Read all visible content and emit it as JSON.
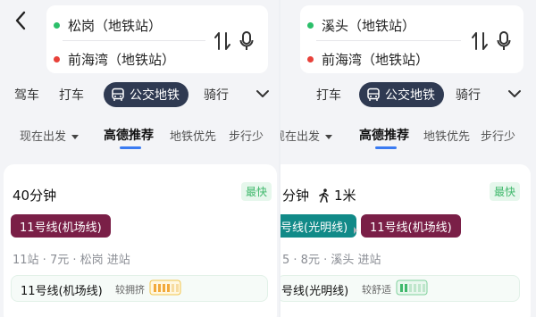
{
  "left": {
    "from": "松岗（地铁站）",
    "to": "前海湾（地铁站）",
    "modes": [
      "驾车",
      "打车",
      "公交地铁",
      "骑行"
    ],
    "prefs": [
      "现在出发",
      "高德推荐",
      "地铁优先",
      "步行少"
    ],
    "card": {
      "duration": "40分钟",
      "badge": "最快",
      "line": "11号线(机场线)",
      "meta": "11站 · 7元 · 松岗  进站",
      "detail_line": "11号线(机场线)",
      "crowd": "较拥挤"
    }
  },
  "right": {
    "from": "溪头（地铁站）",
    "to": "前海湾（地铁站）",
    "modes": [
      "打车",
      "公交地铁",
      "骑行"
    ],
    "prefs": [
      "现在出发",
      "高德推荐",
      "地铁优先",
      "步行少"
    ],
    "card": {
      "duration": "分钟",
      "walk": "1米",
      "badge": "最快",
      "line1": "号线(光明线)",
      "line2": "11号线(机场线)",
      "meta": "5 · 8元 · 溪头  进站",
      "detail_line": "号线(光明线)",
      "crowd": "较舒适"
    }
  },
  "colors": {
    "active_tab": "#2f3a52",
    "line11": "#7a1f47",
    "line_guangming": "#118a88",
    "fastest_badge": "#3fb86b",
    "underline": "#3a7bf2"
  },
  "icons": [
    "back-icon",
    "swap-icon",
    "mic-icon",
    "bus-icon",
    "chevron-down-icon",
    "walk-icon",
    "crowd-icon"
  ]
}
